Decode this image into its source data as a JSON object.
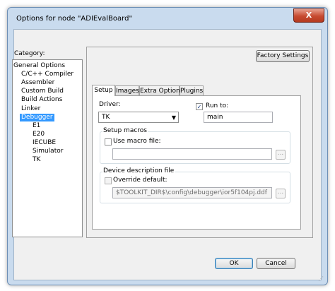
{
  "window": {
    "title": "Options for node \"ADIEvalBoard\"",
    "close_label": "X"
  },
  "category": {
    "label": "Category:",
    "items": [
      "General Options",
      "C/C++ Compiler",
      "Assembler",
      "Custom Build",
      "Build Actions",
      "Linker",
      "Debugger",
      "E1",
      "E20",
      "IECUBE",
      "Simulator",
      "TK"
    ],
    "selected": "Debugger"
  },
  "factory_settings_label": "Factory Settings",
  "tabs": [
    "Setup",
    "Images",
    "Extra Options",
    "Plugins"
  ],
  "active_tab": "Setup",
  "setup": {
    "driver_label": "Driver:",
    "driver_value": "TK",
    "run_to_label": "Run to:",
    "run_to_checked": true,
    "run_to_value": "main",
    "setup_macros_label": "Setup macros",
    "use_macro_file_label": "Use macro file:",
    "use_macro_file_checked": false,
    "macro_file_value": "",
    "device_description_label": "Device description file",
    "override_default_label": "Override default:",
    "override_default_checked": false,
    "ddf_path": "$TOOLKIT_DIR$\\config\\debugger\\ior5f104pj.ddf",
    "browse_label": "..."
  },
  "buttons": {
    "ok": "OK",
    "cancel": "Cancel"
  },
  "icons": {
    "checkmark": "checkmark-icon",
    "dropdown": "chevron-down-icon",
    "close": "close-icon"
  }
}
